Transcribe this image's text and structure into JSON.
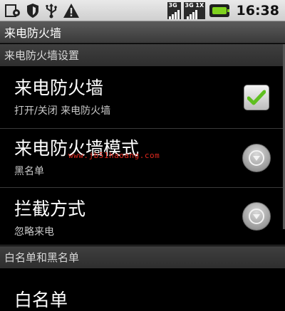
{
  "statusbar": {
    "icons_left": [
      "settings-notification-icon",
      "shield-icon",
      "usb-icon",
      "warning-icon"
    ],
    "network_badges": [
      "3G",
      "3G 1X"
    ],
    "time": "16:38",
    "battery_color": "#7fd21e"
  },
  "titlebar": {
    "title": "来电防火墙"
  },
  "sections": [
    {
      "header": "来电防火墙设置",
      "items": [
        {
          "title": "来电防火墙",
          "summary": "打开/关闭 来电防火墙",
          "control": "checkbox",
          "checked": true
        },
        {
          "title": "来电防火墙模式",
          "summary": "黑名单",
          "control": "dropdown"
        },
        {
          "title": "拦截方式",
          "summary": "忽略来电",
          "control": "dropdown"
        }
      ]
    },
    {
      "header": "白名单和黑名单",
      "items": [
        {
          "title": "白名单"
        }
      ]
    }
  ],
  "watermark": "www.jb51haoang.com",
  "colors": {
    "accent_check": "#5fbf1f",
    "watermark": "#e0281e"
  }
}
